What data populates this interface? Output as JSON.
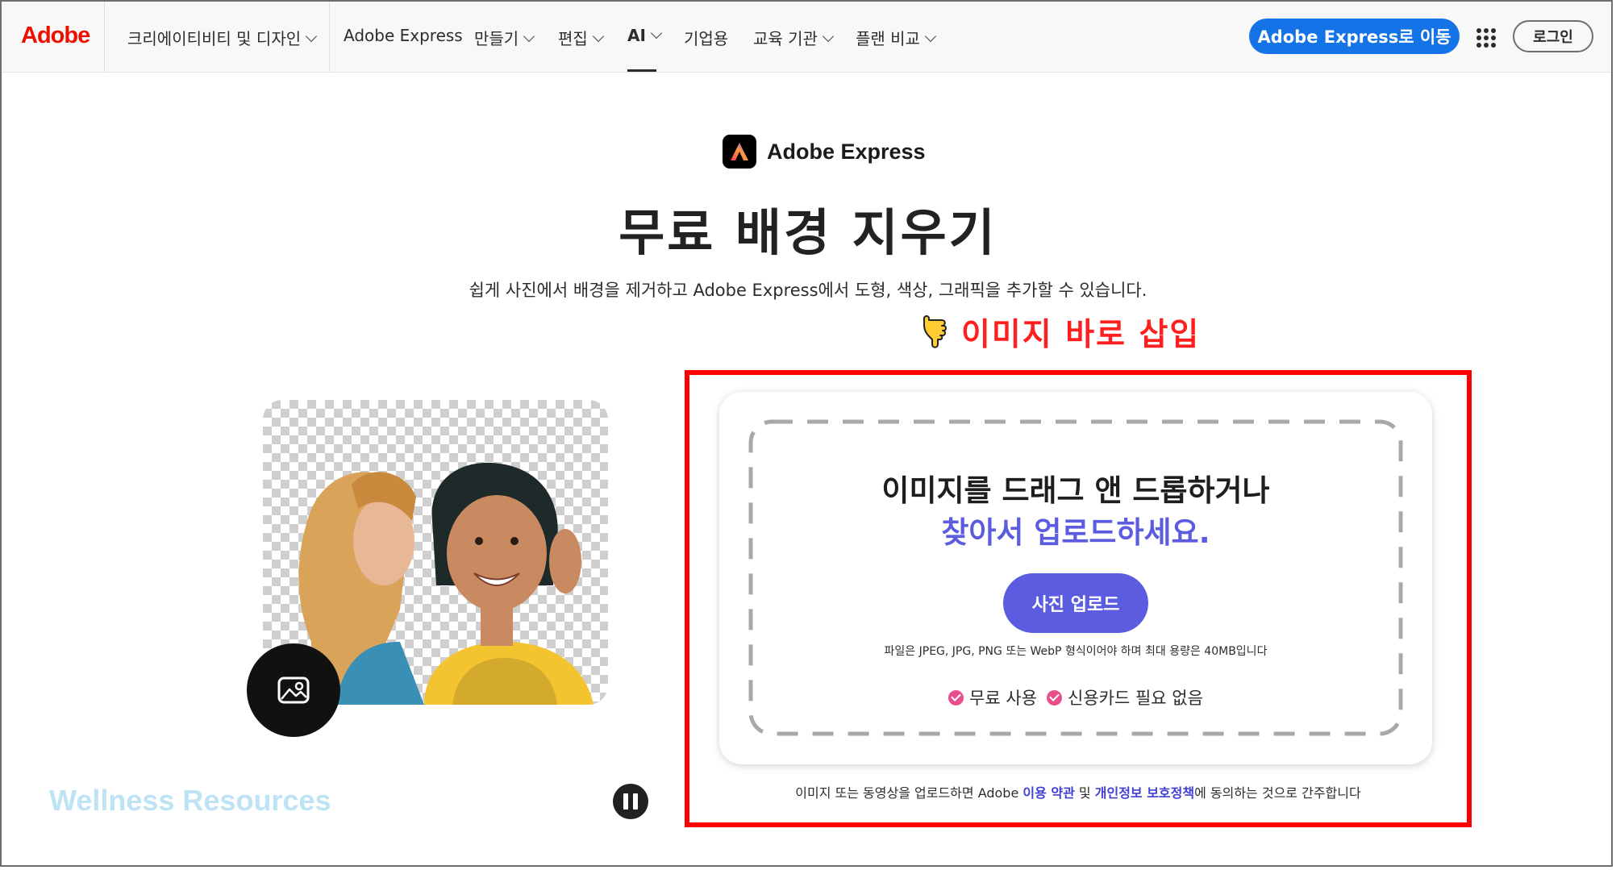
{
  "nav": {
    "logo": "Adobe",
    "items": [
      {
        "label": "크리에이티비티 및 디자인",
        "dropdown": true
      },
      {
        "label": "Adobe Express",
        "dropdown": false
      },
      {
        "label": "만들기",
        "dropdown": true
      },
      {
        "label": "편집",
        "dropdown": true
      },
      {
        "label": "AI",
        "dropdown": true,
        "active": true
      },
      {
        "label": "기업용",
        "dropdown": false
      },
      {
        "label": "교육 기관",
        "dropdown": true
      },
      {
        "label": "플랜 비교",
        "dropdown": true
      }
    ],
    "cta_label": "Adobe Express로 이동",
    "apps_icon": "grid-apps-icon",
    "login_label": "로그인"
  },
  "hero": {
    "brand_name": "Adobe Express",
    "title": "무료 배경 지우기",
    "subtitle": "쉽게 사진에서 배경을 제거하고 Adobe Express에서 도형, 색상, 그래픽을 추가할 수 있습니다."
  },
  "annotation": {
    "icon": "pointing-hand-icon",
    "text": "이미지 바로 삽입",
    "color": "#ff0000"
  },
  "upload": {
    "line1": "이미지를 드래그 앤 드롭하거나",
    "line2": "찾아서 업로드하세요.",
    "button_label": "사진 업로드",
    "format_note": "파일은 JPEG, JPG, PNG 또는 WebP 형식이어야 하며 최대 용량은 40MB입니다",
    "perks": [
      "무료 사용",
      "신용카드 필요 없음"
    ],
    "terms_pre": "이미지 또는 동영상을 업로드하면 Adobe ",
    "terms_link1": "이용 약관",
    "terms_mid": " 및 ",
    "terms_link2": "개인정보 보호정책",
    "terms_post": "에 동의하는 것으로 간주합니다"
  },
  "media": {
    "photo_icon": "image-icon",
    "pause_icon": "pause-icon"
  },
  "watermark": "Wellness Resources",
  "colors": {
    "adobe_red": "#eb1000",
    "cta_blue": "#1473e6",
    "upload_purple": "#5c5ce0",
    "check_pink": "#e94e8c",
    "annotation_red": "#ff1f1f"
  }
}
